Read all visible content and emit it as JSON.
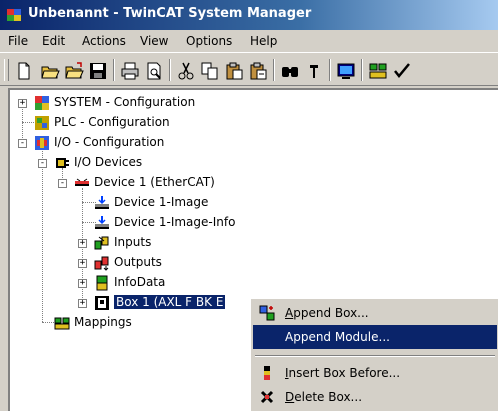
{
  "window": {
    "title": "Unbenannt - TwinCAT System Manager"
  },
  "menu": [
    "File",
    "Edit",
    "Actions",
    "View",
    "Options",
    "Help"
  ],
  "toolbar": {
    "buttons": [
      "new-icon",
      "open-icon",
      "open-folder-icon",
      "save-icon",
      "print-icon",
      "print-preview-icon",
      "cut-icon",
      "copy-icon",
      "paste-icon",
      "paste-special-icon",
      "find-icon",
      "find-next-icon",
      "target-icon",
      "config-icon",
      "check-icon"
    ]
  },
  "tree": [
    {
      "label": "SYSTEM - Configuration",
      "icon": "system-icon",
      "expander": "+"
    },
    {
      "label": "PLC - Configuration",
      "icon": "plc-icon",
      "expander": ""
    },
    {
      "label": "I/O - Configuration",
      "icon": "io-icon",
      "expander": "-"
    },
    {
      "label": "I/O Devices",
      "icon": "io-devices-icon",
      "expander": "-"
    },
    {
      "label": "Device 1 (EtherCAT)",
      "icon": "ethercat-device-icon",
      "expander": "-"
    },
    {
      "label": "Device 1-Image",
      "icon": "device-image-icon",
      "expander": ""
    },
    {
      "label": "Device 1-Image-Info",
      "icon": "device-image-icon",
      "expander": ""
    },
    {
      "label": "Inputs",
      "icon": "inputs-icon",
      "expander": "+"
    },
    {
      "label": "Outputs",
      "icon": "outputs-icon",
      "expander": "+"
    },
    {
      "label": "InfoData",
      "icon": "infodata-icon",
      "expander": "+"
    },
    {
      "label": "Box 1 (AXL F BK E",
      "icon": "box-icon",
      "expander": "+"
    },
    {
      "label": "Mappings",
      "icon": "mappings-icon",
      "expander": ""
    }
  ],
  "context_menu": {
    "items": [
      {
        "label": "Append Box...",
        "mnemonic": "A",
        "rest": "ppend Box...",
        "icon": "append-box-icon"
      },
      {
        "label": "Append Module...",
        "mnemonic": "",
        "rest": "",
        "icon": ""
      },
      {
        "label": "Insert Box Before...",
        "mnemonic": "I",
        "rest": "nsert Box Before...",
        "icon": "insert-box-icon"
      },
      {
        "label": "Delete Box...",
        "mnemonic": "D",
        "rest": "elete Box...",
        "icon": "delete-box-icon"
      }
    ]
  },
  "colors": {
    "title_bar": "#0a246a",
    "highlight": "#0a246a",
    "face": "#d4d0c8"
  }
}
